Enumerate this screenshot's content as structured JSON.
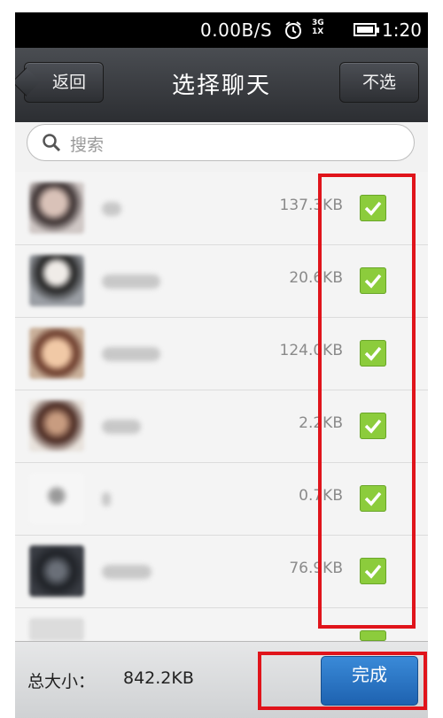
{
  "status_bar": {
    "net_speed": "0.00B/S",
    "network_top": "3G",
    "network_bottom": "1X",
    "time": "1:20"
  },
  "title_bar": {
    "back_label": "返回",
    "title": "选择聊天",
    "deselect_label": "不选"
  },
  "search": {
    "placeholder": "搜索"
  },
  "chats": [
    {
      "size": "137.3KB",
      "checked": true
    },
    {
      "size": "20.6KB",
      "checked": true
    },
    {
      "size": "124.0KB",
      "checked": true
    },
    {
      "size": "2.2KB",
      "checked": true
    },
    {
      "size": "0.7KB",
      "checked": true
    },
    {
      "size": "76.9KB",
      "checked": true
    }
  ],
  "footer": {
    "total_label": "总大小：",
    "total_value": "842.2KB",
    "done_label": "完成"
  },
  "colors": {
    "checkbox": "#8ccc3c",
    "done_button": "#2a74c4",
    "highlight": "#e0141b",
    "title_bar": "#3a3c40"
  }
}
